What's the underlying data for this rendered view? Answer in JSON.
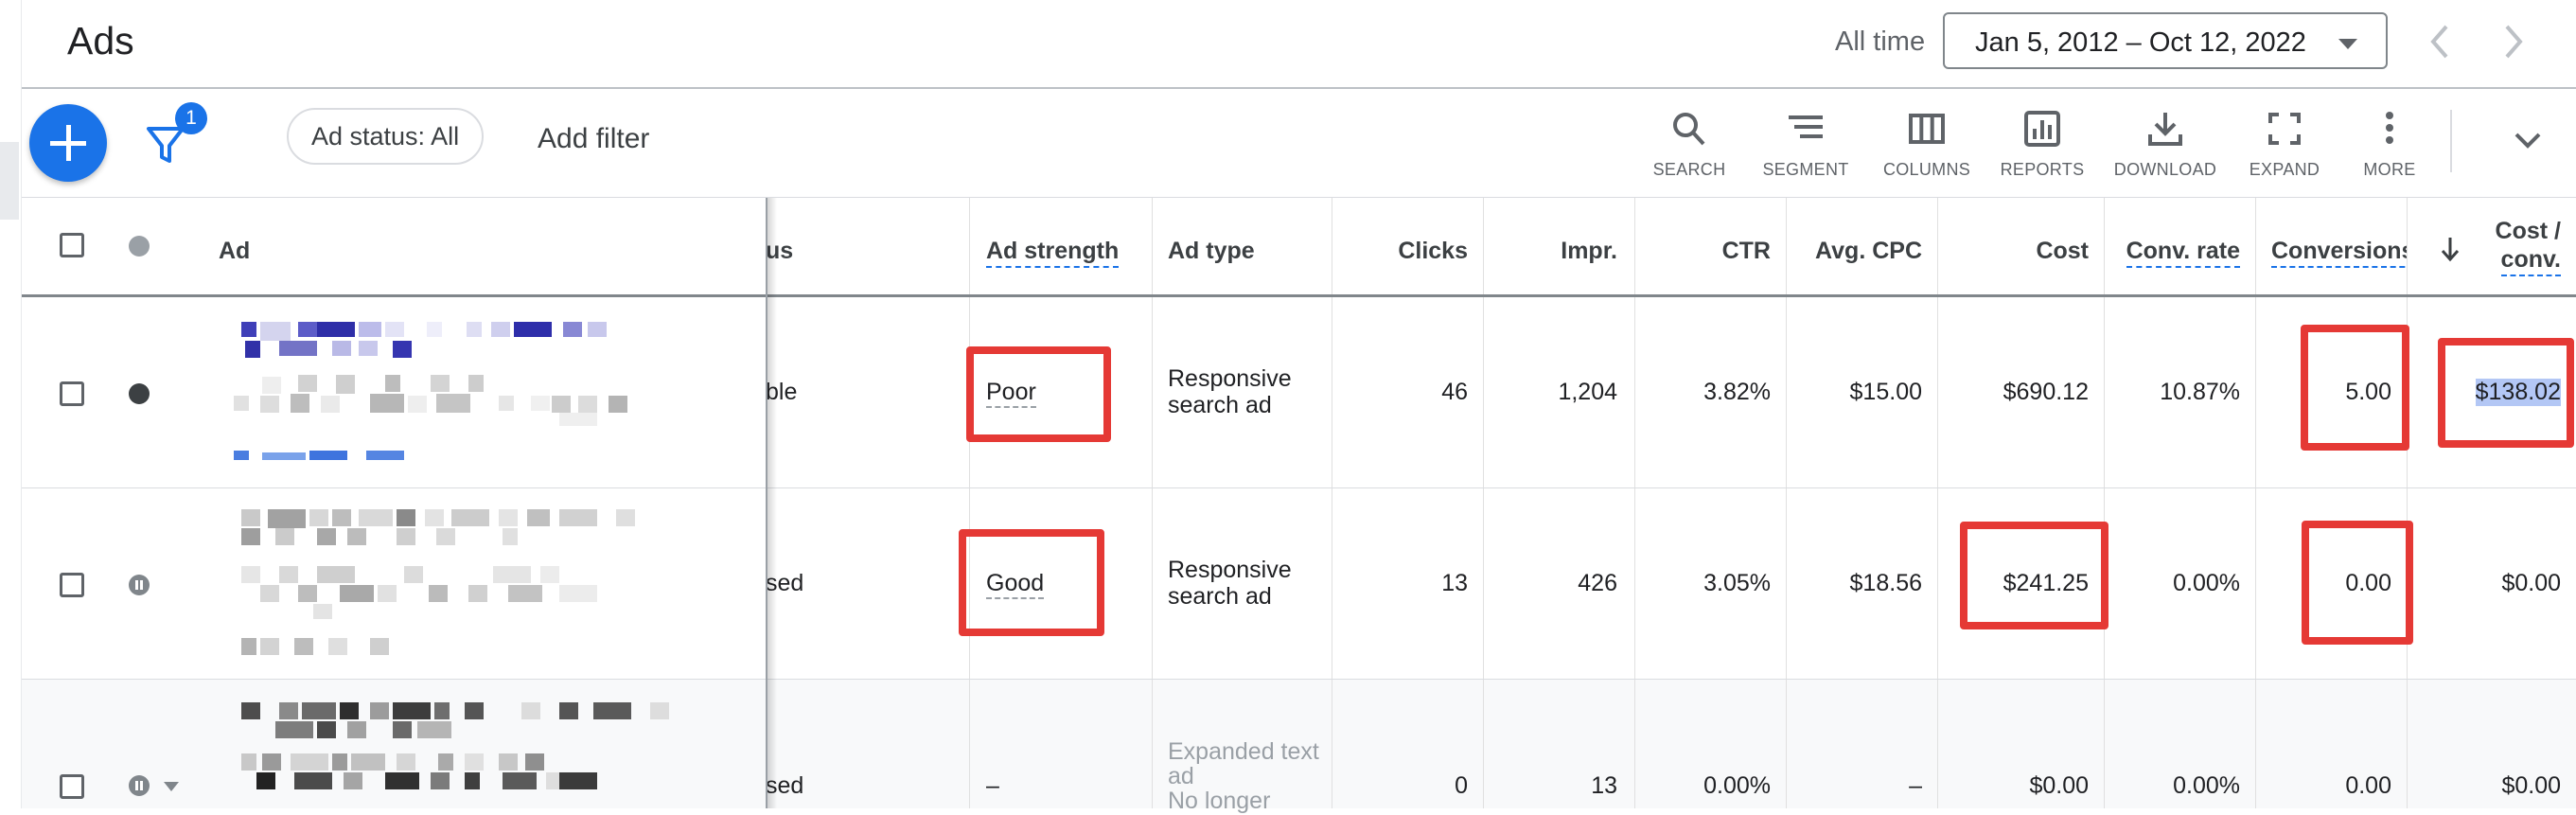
{
  "header": {
    "title": "Ads",
    "range_label": "All time",
    "date_range": "Jan 5, 2012 – Oct 12, 2022"
  },
  "toolbar": {
    "filter_badge": "1",
    "status_chip": "Ad status: All",
    "add_filter": "Add filter",
    "tools": [
      {
        "label": "SEARCH",
        "icon": "search-icon"
      },
      {
        "label": "SEGMENT",
        "icon": "segment-icon"
      },
      {
        "label": "COLUMNS",
        "icon": "columns-icon"
      },
      {
        "label": "REPORTS",
        "icon": "reports-icon"
      },
      {
        "label": "DOWNLOAD",
        "icon": "download-icon"
      },
      {
        "label": "EXPAND",
        "icon": "expand-icon"
      },
      {
        "label": "MORE",
        "icon": "more-vert-icon"
      }
    ]
  },
  "table": {
    "headers": {
      "ad": "Ad",
      "status": "us",
      "ad_strength": "Ad strength",
      "ad_type": "Ad type",
      "clicks": "Clicks",
      "impr": "Impr.",
      "ctr": "CTR",
      "avg_cpc": "Avg. CPC",
      "cost": "Cost",
      "conv_rate": "Conv. rate",
      "conversions": "Conversions",
      "cost_conv_1": "Cost /",
      "cost_conv_2": "conv."
    },
    "rows": [
      {
        "status": "ble",
        "ad_strength": "Poor",
        "ad_type_1": "Responsive",
        "ad_type_2": "search ad",
        "clicks": "46",
        "impr": "1,204",
        "ctr": "3.82%",
        "avg_cpc": "$15.00",
        "cost": "$690.12",
        "conv_rate": "10.87%",
        "conversions": "5.00",
        "cost_conv": "$138.02"
      },
      {
        "status": "sed",
        "ad_strength": "Good",
        "ad_type_1": "Responsive",
        "ad_type_2": "search ad",
        "clicks": "13",
        "impr": "426",
        "ctr": "3.05%",
        "avg_cpc": "$18.56",
        "cost": "$241.25",
        "conv_rate": "0.00%",
        "conversions": "0.00",
        "cost_conv": "$0.00"
      },
      {
        "status": "sed",
        "ad_strength": "–",
        "ad_type_1": "Expanded text",
        "ad_type_2": "ad",
        "ad_type_3": "No longer",
        "clicks": "0",
        "impr": "13",
        "ctr": "0.00%",
        "avg_cpc": "–",
        "cost": "$0.00",
        "conv_rate": "0.00%",
        "conversions": "0.00",
        "cost_conv": "$0.00"
      }
    ]
  },
  "colors": {
    "accent": "#1a73e8",
    "highlight": "#e53935",
    "selection": "#b3c7f5"
  }
}
